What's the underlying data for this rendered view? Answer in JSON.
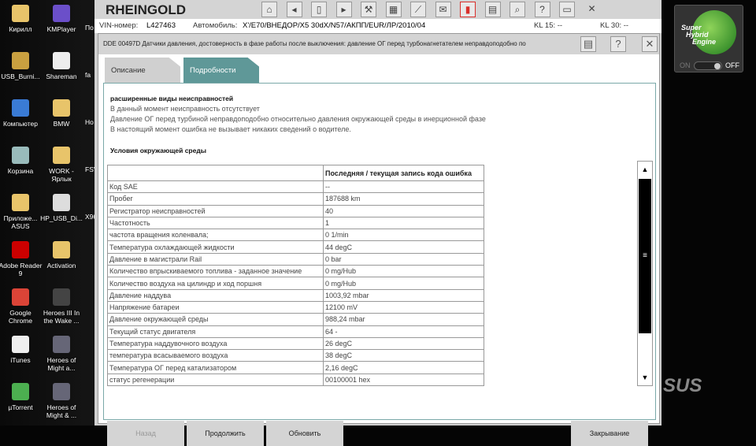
{
  "desktop": {
    "icons": [
      {
        "label": "Кирилл",
        "color": "#e8c46a"
      },
      {
        "label": "KMPlayer",
        "color": "#6b4fc9"
      },
      {
        "label": "USB_Burni...",
        "color": "#c9a040"
      },
      {
        "label": "Shareman",
        "color": "#eee"
      },
      {
        "label": "Компьютер",
        "color": "#3a7bd5"
      },
      {
        "label": "BMW",
        "color": "#e8c46a"
      },
      {
        "label": "Корзина",
        "color": "#9bb"
      },
      {
        "label": "WORK - Ярлык",
        "color": "#e8c46a"
      },
      {
        "label": "Приложе... ASUS",
        "color": "#e8c46a"
      },
      {
        "label": "HP_USB_Di...",
        "color": "#ddd"
      },
      {
        "label": "Adobe Reader 9",
        "color": "#c00"
      },
      {
        "label": "Activation",
        "color": "#e8c46a"
      },
      {
        "label": "Google Chrome",
        "color": "#db4437"
      },
      {
        "label": "Heroes III In the Wake ...",
        "color": "#444"
      },
      {
        "label": "iTunes",
        "color": "#eee"
      },
      {
        "label": "Heroes of Might a...",
        "color": "#667"
      },
      {
        "label": "µTorrent",
        "color": "#4caf50"
      },
      {
        "label": "Heroes of Might & ...",
        "color": "#667"
      }
    ],
    "partial": [
      "По",
      "fa",
      "Но",
      "FSV",
      "X96"
    ]
  },
  "app": {
    "title": "RHEINGOLD",
    "vin_label": "VIN-номер:",
    "vin": "L427463",
    "car_label": "Автомобиль:",
    "car": "X'/E70/ВНЕДОР/X5 30dX/N57/АКПП/EUR/ЛР/2010/04",
    "kl15": "KL 15:  --",
    "kl30": "KL 30:  --"
  },
  "toolbar": [
    "home-icon",
    "back-icon",
    "documents-icon",
    "forward-icon",
    "wrench-icon",
    "vehicle-data-icon",
    "connection-icon",
    "mail-icon",
    "battery-icon",
    "print-icon",
    "zoom-icon",
    "help-icon",
    "minimize-icon",
    "close-icon"
  ],
  "dialog": {
    "title": "DDE 00497D Датчики давления, достоверность в фазе работы после выключения: давление ОГ перед турбонагнетателем неправдоподобно по",
    "tabs": [
      "Описание",
      "Подробности"
    ],
    "active_tab": 1,
    "heading": "расширенные виды неисправностей",
    "lines": [
      "В данный момент неисправность отсутствует",
      "Давление ОГ перед турбиной неправдоподобно относительно давления окружающей среды в инерционной фазе",
      "В настоящий момент ошибка не вызывает никаких сведений о водителе."
    ],
    "section": "Условия окружающей среды",
    "col_header": "Последняя / текущая запись кода ошибка",
    "rows": [
      [
        "Код SAE",
        "--"
      ],
      [
        "Пробег",
        "187688 km"
      ],
      [
        "Регистратор неисправностей",
        "40"
      ],
      [
        "Частотность",
        "1"
      ],
      [
        "частота вращения коленвала;",
        "0 1/min"
      ],
      [
        "Температура охлаждающей жидкости",
        "44 degC"
      ],
      [
        "Давление в магистрали Rail",
        "0 bar"
      ],
      [
        "Количество впрыскиваемого топлива - заданное значение",
        "0 mg/Hub"
      ],
      [
        "Количество воздуха на цилиндр и ход поршня",
        "0 mg/Hub"
      ],
      [
        "Давление наддува",
        "1003,92 mbar"
      ],
      [
        "Напряжение батареи",
        "12100 mV"
      ],
      [
        "Давление окружающей среды",
        "988,24 mbar"
      ],
      [
        "Текущий статус двигателя",
        "64 -"
      ],
      [
        "Температура наддувочного воздуха",
        "26 degC"
      ],
      [
        "температура всасываемого воздуха",
        "38 degC"
      ],
      [
        "Температура ОГ перед катализатором",
        "2,16 degC"
      ],
      [
        "статус регенерации",
        "00100001 hex"
      ]
    ],
    "buttons": {
      "back": "Назад",
      "continue": "Продолжить",
      "refresh": "Обновить",
      "close": "Закрывание"
    }
  },
  "she": {
    "line1": "Super",
    "line2": "Hybrid",
    "line3": "Engine",
    "on": "ON",
    "off": "OFF"
  },
  "brand": "SUS",
  "colors": {
    "accent": "#5f9898",
    "battery": "#d9302c"
  }
}
